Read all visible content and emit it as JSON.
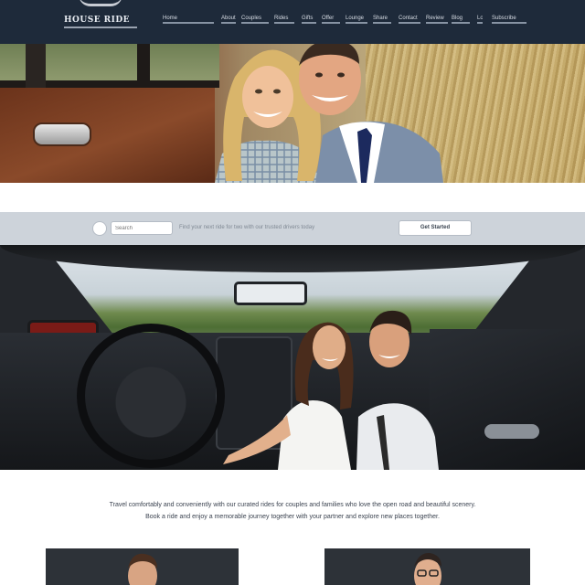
{
  "header": {
    "logo_text": "HOUSE RIDE",
    "nav": [
      "Home",
      "About",
      "Couples",
      "Rides",
      "Gifts",
      "Offer",
      "Lounge",
      "Share",
      "Contact",
      "Review",
      "Blog",
      "Login",
      "Subscribe"
    ]
  },
  "search": {
    "placeholder": "Search",
    "hint": "Find your next ride for two with our trusted drivers today",
    "button_label": "Get Started"
  },
  "content": {
    "body_line1": "Travel comfortably and conveniently with our curated rides for couples and families who love the open road and beautiful scenery.",
    "body_line2": "Book a ride and enjoy a memorable journey together with your partner and explore new places together."
  },
  "colors": {
    "header_bg": "#1e2a3a",
    "band_bg": "#cdd3da",
    "card_bg": "#2d3238"
  },
  "icons": [
    "radio-dot-icon"
  ]
}
